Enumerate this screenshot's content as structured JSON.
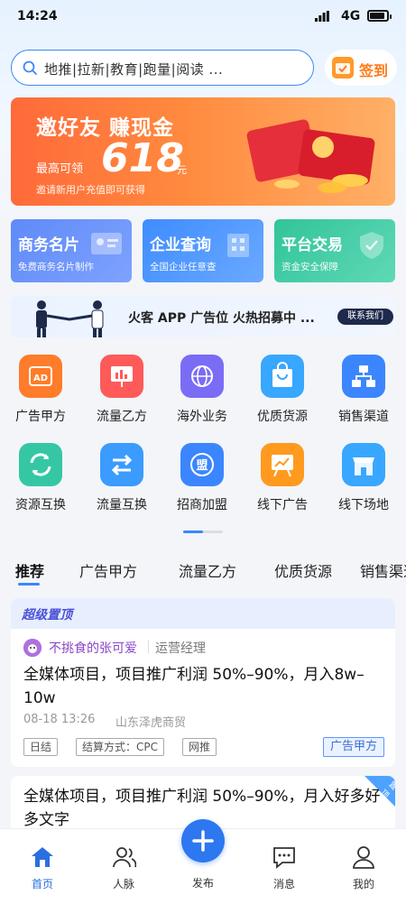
{
  "status_bar": {
    "time": "14:24",
    "network": "4G"
  },
  "search": {
    "placeholder": "地推|拉新|教育|跑量|阅读 ..."
  },
  "sign_in": {
    "label": "签到"
  },
  "banner": {
    "title": "邀好友 赚现金",
    "prefix": "最高可领",
    "amount": "618",
    "unit": "元",
    "note": "邀请新用户充值即可获得"
  },
  "quick_cards": [
    {
      "title": "商务名片",
      "sub": "免费商务名片制作"
    },
    {
      "title": "企业查询",
      "sub": "全国企业任意查"
    },
    {
      "title": "平台交易",
      "sub": "资金安全保障"
    }
  ],
  "ad_bar": {
    "text": "火客 APP 广告位 火热招募中 ...",
    "button": "联系我们"
  },
  "grid": [
    {
      "label": "广告甲方",
      "icon": "ad-icon",
      "color": "#ff7c2a"
    },
    {
      "label": "流量乙方",
      "icon": "chart-board-icon",
      "color": "#ff5a5a"
    },
    {
      "label": "海外业务",
      "icon": "globe-icon",
      "color": "#7b6cf5"
    },
    {
      "label": "优质货源",
      "icon": "shopping-bag-icon",
      "color": "#38a7ff"
    },
    {
      "label": "销售渠道",
      "icon": "hierarchy-icon",
      "color": "#3b86ff"
    },
    {
      "label": "资源互换",
      "icon": "refresh-icon",
      "color": "#35c7a4"
    },
    {
      "label": "流量互换",
      "icon": "swap-arrows-icon",
      "color": "#3b9bff"
    },
    {
      "label": "招商加盟",
      "icon": "franchise-icon",
      "color": "#3b86ff"
    },
    {
      "label": "线下广告",
      "icon": "billboard-icon",
      "color": "#ff9a1f"
    },
    {
      "label": "线下场地",
      "icon": "storefront-icon",
      "color": "#38a7ff"
    }
  ],
  "tabs": [
    "推荐",
    "广告甲方",
    "流量乙方",
    "优质货源",
    "销售渠道"
  ],
  "card1": {
    "badge": "超级置顶",
    "user": "不挑食的张可爱",
    "role": "运营经理",
    "title": "全媒体项目，项目推广利润 50%–90%，月入8w–10w",
    "date": "08-18 13:26",
    "company": "山东泽虎商贸",
    "tags": [
      "日结",
      "结算方式：CPC",
      "网推"
    ],
    "category": "广告甲方"
  },
  "card2": {
    "corner": "置顶",
    "title": "全媒体项目，项目推广利润 50%–90%，月入好多好多文字"
  },
  "bottom_nav": [
    {
      "label": "首页"
    },
    {
      "label": "人脉"
    },
    {
      "label": "发布"
    },
    {
      "label": "消息"
    },
    {
      "label": "我的"
    }
  ],
  "colors": {
    "primary": "#3b86ff",
    "accent_orange": "#ff7a17"
  }
}
